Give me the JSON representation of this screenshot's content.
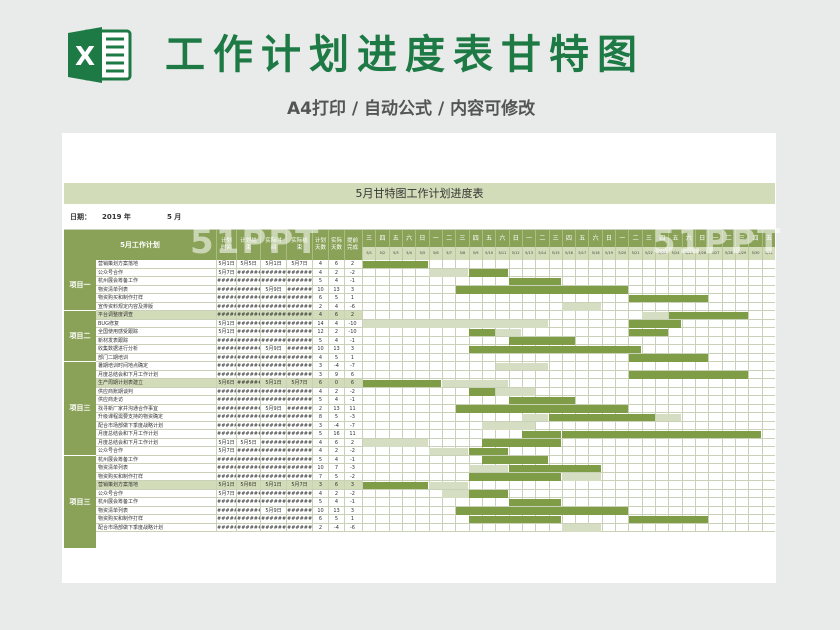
{
  "header": {
    "title": "工作计划进度表甘特图",
    "subtitle": "A4打印 / 自动公式 / 内容可修改",
    "logo_letter": "X"
  },
  "colors": {
    "brand": "#1d7a45",
    "band": "#d3dcb8",
    "dark": "#8aa257",
    "bar": "#7f9d46",
    "light": "#d5dec2",
    "grid": "#c9d1b8"
  },
  "sheet": {
    "title": "5月甘特图工作计划进度表",
    "date_label": "日期：",
    "year_text": "2019  年",
    "month_text": "5    月",
    "headers": {
      "task": "5月工作计划",
      "plan_start": "计划时间",
      "plan_end": "计划结束",
      "actual_start": "实际时间",
      "actual_end": "实际结束",
      "plan_days": "计划天数",
      "actual_days": "实际天数",
      "early": "提前完成"
    },
    "weekdays": [
      "三",
      "四",
      "五",
      "六",
      "日",
      "一",
      "二",
      "三",
      "四",
      "五",
      "六",
      "日",
      "一",
      "二",
      "三",
      "四",
      "五",
      "六",
      "日",
      "一",
      "二",
      "三",
      "四",
      "五",
      "六",
      "日",
      "一",
      "二",
      "三",
      "四",
      "五"
    ],
    "dates": [
      "5/1",
      "5/2",
      "5/3",
      "5/4",
      "5/5",
      "5/6",
      "5/7",
      "5/8",
      "5/9",
      "5/10",
      "5/11",
      "5/12",
      "5/13",
      "5/14",
      "5/15",
      "5/16",
      "5/17",
      "5/18",
      "5/19",
      "5/20",
      "5/21",
      "5/22",
      "5/23",
      "5/24",
      "5/25",
      "5/26",
      "5/27",
      "5/28",
      "5/29",
      "5/30",
      "5/31"
    ],
    "groups": [
      {
        "label": "项目一",
        "start": 0,
        "count": 6
      },
      {
        "label": "项目二",
        "start": 6,
        "count": 6
      },
      {
        "label": "项目三",
        "start": 12,
        "count": 11
      },
      {
        "label": "项目三",
        "start": 23,
        "count": 11
      }
    ],
    "rows": [
      {
        "task": "营销策划方案落地",
        "ps": "5月1日",
        "pe": "5月5日",
        "as": "5月1日",
        "ae": "5月7日",
        "pd": "4",
        "ad": "6",
        "e": "2",
        "style": "w",
        "bars": [
          [
            0,
            5,
            1
          ]
        ]
      },
      {
        "task": "公众号合作",
        "ps": "5月7日",
        "pe": "######",
        "as": "######",
        "ae": "######",
        "pd": "4",
        "ad": "2",
        "e": "-2",
        "style": "w",
        "bars": [
          [
            5,
            3,
            2
          ],
          [
            8,
            3,
            1
          ]
        ]
      },
      {
        "task": "杭州展会筹备工作",
        "ps": "######",
        "pe": "######",
        "as": "######",
        "ae": "######",
        "pd": "5",
        "ad": "4",
        "e": "-1",
        "style": "w",
        "bars": [
          [
            11,
            4,
            1
          ]
        ]
      },
      {
        "task": "物资清单列表",
        "ps": "######",
        "pe": "######",
        "as": "5月9日",
        "ae": "######",
        "pd": "10",
        "ad": "13",
        "e": "3",
        "style": "w",
        "bars": [
          [
            7,
            13,
            1
          ]
        ]
      },
      {
        "task": "物资购买和制作打样",
        "ps": "######",
        "pe": "######",
        "as": "######",
        "ae": "######",
        "pd": "6",
        "ad": "5",
        "e": "1",
        "style": "w",
        "bars": [
          [
            20,
            6,
            1
          ]
        ]
      },
      {
        "task": "宣传资料规定内容及排版",
        "ps": "######",
        "pe": "######",
        "as": "######",
        "ae": "######",
        "pd": "2",
        "ad": "4",
        "e": "-6",
        "style": "w",
        "bars": [
          [
            15,
            3,
            2
          ]
        ]
      },
      {
        "task": "平台调整度调查",
        "ps": "######",
        "pe": "######",
        "as": "######",
        "ae": "######",
        "pd": "4",
        "ad": "6",
        "e": "2",
        "style": "g",
        "bars": [
          [
            21,
            2,
            2
          ],
          [
            23,
            6,
            1
          ]
        ]
      },
      {
        "task": "BUG修复",
        "ps": "5月1日",
        "pe": "######",
        "as": "######",
        "ae": "######",
        "pd": "14",
        "ad": "4",
        "e": "-10",
        "style": "w",
        "bars": [
          [
            0,
            14,
            2
          ],
          [
            20,
            4,
            1
          ]
        ]
      },
      {
        "task": "全国使用感受跟踪",
        "ps": "5月1日",
        "pe": "######",
        "as": "######",
        "ae": "######",
        "pd": "12",
        "ad": "2",
        "e": "-10",
        "style": "w",
        "bars": [
          [
            8,
            2,
            1
          ],
          [
            10,
            2,
            2
          ],
          [
            20,
            3,
            1
          ]
        ]
      },
      {
        "task": "新材发表跟踪",
        "ps": "######",
        "pe": "######",
        "as": "######",
        "ae": "######",
        "pd": "5",
        "ad": "4",
        "e": "-1",
        "style": "w",
        "bars": [
          [
            11,
            5,
            1
          ]
        ]
      },
      {
        "task": "收集数据进行分析",
        "ps": "######",
        "pe": "######",
        "as": "5月9日",
        "ae": "######",
        "pd": "10",
        "ad": "13",
        "e": "3",
        "style": "w",
        "bars": [
          [
            8,
            13,
            1
          ]
        ]
      },
      {
        "task": "部门二期培训",
        "ps": "######",
        "pe": "######",
        "as": "######",
        "ae": "######",
        "pd": "4",
        "ad": "5",
        "e": "1",
        "style": "w",
        "bars": [
          [
            20,
            6,
            1
          ]
        ]
      },
      {
        "task": "暑期培训时间地点确定",
        "ps": "######",
        "pe": "######",
        "as": "######",
        "ae": "######",
        "pd": "3",
        "ad": "-4",
        "e": "-7",
        "style": "w",
        "bars": [
          [
            10,
            4,
            2
          ]
        ]
      },
      {
        "task": "月度总结会和下月工作计划",
        "ps": "######",
        "pe": "######",
        "as": "######",
        "ae": "######",
        "pd": "3",
        "ad": "9",
        "e": "6",
        "style": "w",
        "bars": [
          [
            20,
            9,
            1
          ]
        ]
      },
      {
        "task": "生产周期计划表建立",
        "ps": "5月6日",
        "pe": "######",
        "as": "5月1日",
        "ae": "5月7日",
        "pd": "6",
        "ad": "0",
        "e": "6",
        "style": "g",
        "bars": [
          [
            0,
            6,
            1
          ],
          [
            6,
            5,
            2
          ]
        ]
      },
      {
        "task": "供应商账期谈判",
        "ps": "######",
        "pe": "######",
        "as": "######",
        "ae": "######",
        "pd": "4",
        "ad": "2",
        "e": "-2",
        "style": "w",
        "bars": [
          [
            8,
            2,
            1
          ],
          [
            10,
            3,
            2
          ]
        ]
      },
      {
        "task": "供应商走访",
        "ps": "######",
        "pe": "######",
        "as": "######",
        "ae": "######",
        "pd": "5",
        "ad": "4",
        "e": "-1",
        "style": "w",
        "bars": [
          [
            11,
            5,
            1
          ]
        ]
      },
      {
        "task": "找寻新厂家并沟通合作事宜",
        "ps": "######",
        "pe": "######",
        "as": "5月9日",
        "ae": "######",
        "pd": "2",
        "ad": "13",
        "e": "11",
        "style": "w",
        "bars": [
          [
            7,
            13,
            1
          ]
        ]
      },
      {
        "task": "升级课程需要支持的物资确定",
        "ps": "######",
        "pe": "######",
        "as": "######",
        "ae": "######",
        "pd": "8",
        "ad": "5",
        "e": "-3",
        "style": "w",
        "bars": [
          [
            12,
            2,
            2
          ],
          [
            14,
            8,
            1
          ],
          [
            22,
            2,
            2
          ]
        ]
      },
      {
        "task": "配合市场部做下季度战略计划",
        "ps": "######",
        "pe": "######",
        "as": "######",
        "ae": "######",
        "pd": "3",
        "ad": "-4",
        "e": "-7",
        "style": "w",
        "bars": [
          [
            9,
            4,
            2
          ]
        ]
      },
      {
        "task": "月度总结会和下月工作计划",
        "ps": "######",
        "pe": "######",
        "as": "######",
        "ae": "######",
        "pd": "5",
        "ad": "16",
        "e": "11",
        "style": "w",
        "bars": [
          [
            12,
            3,
            1
          ],
          [
            15,
            15,
            1
          ]
        ]
      },
      {
        "task": "月度总结会和下月工作计划",
        "ps": "5月1日",
        "pe": "5月5日",
        "as": "######",
        "ae": "######",
        "pd": "4",
        "ad": "6",
        "e": "2",
        "style": "w",
        "bars": [
          [
            0,
            5,
            2
          ],
          [
            9,
            6,
            1
          ]
        ]
      },
      {
        "task": "公众号合作",
        "ps": "5月7日",
        "pe": "######",
        "as": "######",
        "ae": "######",
        "pd": "4",
        "ad": "2",
        "e": "-2",
        "style": "w",
        "bars": [
          [
            5,
            3,
            2
          ],
          [
            8,
            3,
            1
          ]
        ]
      },
      {
        "task": "杭州展会筹备工作",
        "ps": "######",
        "pe": "######",
        "as": "######",
        "ae": "######",
        "pd": "5",
        "ad": "4",
        "e": "-1",
        "style": "w",
        "bars": [
          [
            9,
            5,
            1
          ]
        ]
      },
      {
        "task": "物资清单列表",
        "ps": "######",
        "pe": "######",
        "as": "######",
        "ae": "######",
        "pd": "10",
        "ad": "7",
        "e": "-3",
        "style": "w",
        "bars": [
          [
            8,
            3,
            2
          ],
          [
            11,
            7,
            1
          ]
        ]
      },
      {
        "task": "物资购买和制作打样",
        "ps": "######",
        "pe": "######",
        "as": "######",
        "ae": "######",
        "pd": "7",
        "ad": "5",
        "e": "-2",
        "style": "w",
        "bars": [
          [
            8,
            7,
            1
          ],
          [
            15,
            3,
            2
          ]
        ]
      },
      {
        "task": "营销策划方案落地",
        "ps": "5月1日",
        "pe": "5月6日",
        "as": "5月1日",
        "ae": "5月7日",
        "pd": "3",
        "ad": "6",
        "e": "3",
        "style": "g",
        "bars": [
          [
            0,
            5,
            1
          ],
          [
            5,
            3,
            2
          ]
        ]
      },
      {
        "task": "公众号合作",
        "ps": "5月7日",
        "pe": "######",
        "as": "######",
        "ae": "######",
        "pd": "4",
        "ad": "2",
        "e": "-2",
        "style": "w",
        "bars": [
          [
            6,
            3,
            2
          ],
          [
            8,
            3,
            1
          ]
        ]
      },
      {
        "task": "杭州展会筹备工作",
        "ps": "######",
        "pe": "######",
        "as": "######",
        "ae": "######",
        "pd": "5",
        "ad": "4",
        "e": "-1",
        "style": "w",
        "bars": [
          [
            11,
            4,
            1
          ]
        ]
      },
      {
        "task": "物资清单列表",
        "ps": "######",
        "pe": "######",
        "as": "5月9日",
        "ae": "######",
        "pd": "10",
        "ad": "13",
        "e": "3",
        "style": "w",
        "bars": [
          [
            7,
            13,
            1
          ]
        ]
      },
      {
        "task": "物资购买和制作打样",
        "ps": "######",
        "pe": "######",
        "as": "######",
        "ae": "######",
        "pd": "6",
        "ad": "5",
        "e": "1",
        "style": "w",
        "bars": [
          [
            8,
            7,
            1
          ],
          [
            20,
            6,
            1
          ]
        ]
      },
      {
        "task": "配合市场部做下季度战略计划",
        "ps": "######",
        "pe": "######",
        "as": "######",
        "ae": "######",
        "pd": "2",
        "ad": "-4",
        "e": "-6",
        "style": "w",
        "bars": [
          [
            15,
            3,
            2
          ]
        ]
      }
    ]
  },
  "watermarks": [
    "51PPT",
    "51PPT"
  ]
}
